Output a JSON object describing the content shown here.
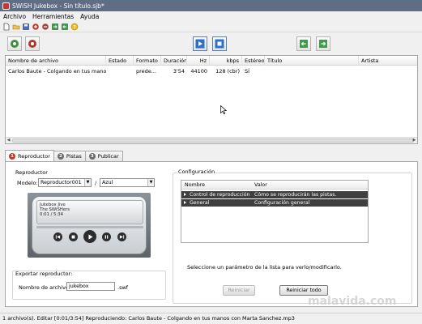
{
  "window": {
    "title": "SWiSH Jukebox - Sin título.sjb*"
  },
  "menu": [
    "Archivo",
    "Herramientas",
    "Ayuda"
  ],
  "toolbar": {
    "icons": [
      "new-file-icon",
      "open-folder-icon",
      "save-icon",
      "add-song-icon",
      "remove-song-icon",
      "export-icon",
      "import-icon",
      "help-icon"
    ]
  },
  "actionbar": {
    "icons": [
      "add-track-icon",
      "remove-track-icon",
      "play-icon",
      "stop-icon",
      "move-up-icon",
      "move-down-icon"
    ]
  },
  "playlist": {
    "columns": [
      "Nombre de archivo",
      "Estado",
      "Formato",
      "Duración",
      "Hz",
      "kbps",
      "Estéreo",
      "Título",
      "Artista"
    ],
    "rows": [
      [
        "Carlos Baute - Colgando en tus manos ...",
        "",
        "prede...",
        "3'54",
        "44100",
        "128 (cbr)",
        "SÍ",
        "",
        ""
      ]
    ]
  },
  "tabs": [
    {
      "num": "1",
      "label": "Reproductor"
    },
    {
      "num": "2",
      "label": "Pistas"
    },
    {
      "num": "3",
      "label": "Publicar"
    }
  ],
  "player": {
    "group_label": "Reproductor",
    "model_label": "Modelo:",
    "model_value": "Reproductor001",
    "separator": "/",
    "skin_value": "Azul",
    "screen_line1": "Jukebox Jive",
    "screen_line2": "The SWiSHers",
    "screen_line3": "0:01 / 5:34"
  },
  "export": {
    "group_label": "Exportar reproductor:",
    "filename_label": "Nombre de archivo:",
    "filename_value": "jukebox",
    "extension": ".swf"
  },
  "config": {
    "group_label": "Configuración",
    "col_name": "Nombre",
    "col_value": "Valor",
    "rows": [
      {
        "name": "Control de reproducción",
        "value": "Cómo se reproducirán las pistas."
      },
      {
        "name": "General",
        "value": "Configuración general"
      }
    ],
    "hint": "Seleccione un parámetro de la lista para verlo/modificarlo.",
    "reset_button": "Reiniciar",
    "reset_all_button": "Reiniciar todo"
  },
  "status": "1 archivo(s). Editar [0:01/3:54] Reproduciendo: Carlos Baute - Colgando en tus manos con Marta Sanchez.mp3",
  "watermark": "malavida.com"
}
